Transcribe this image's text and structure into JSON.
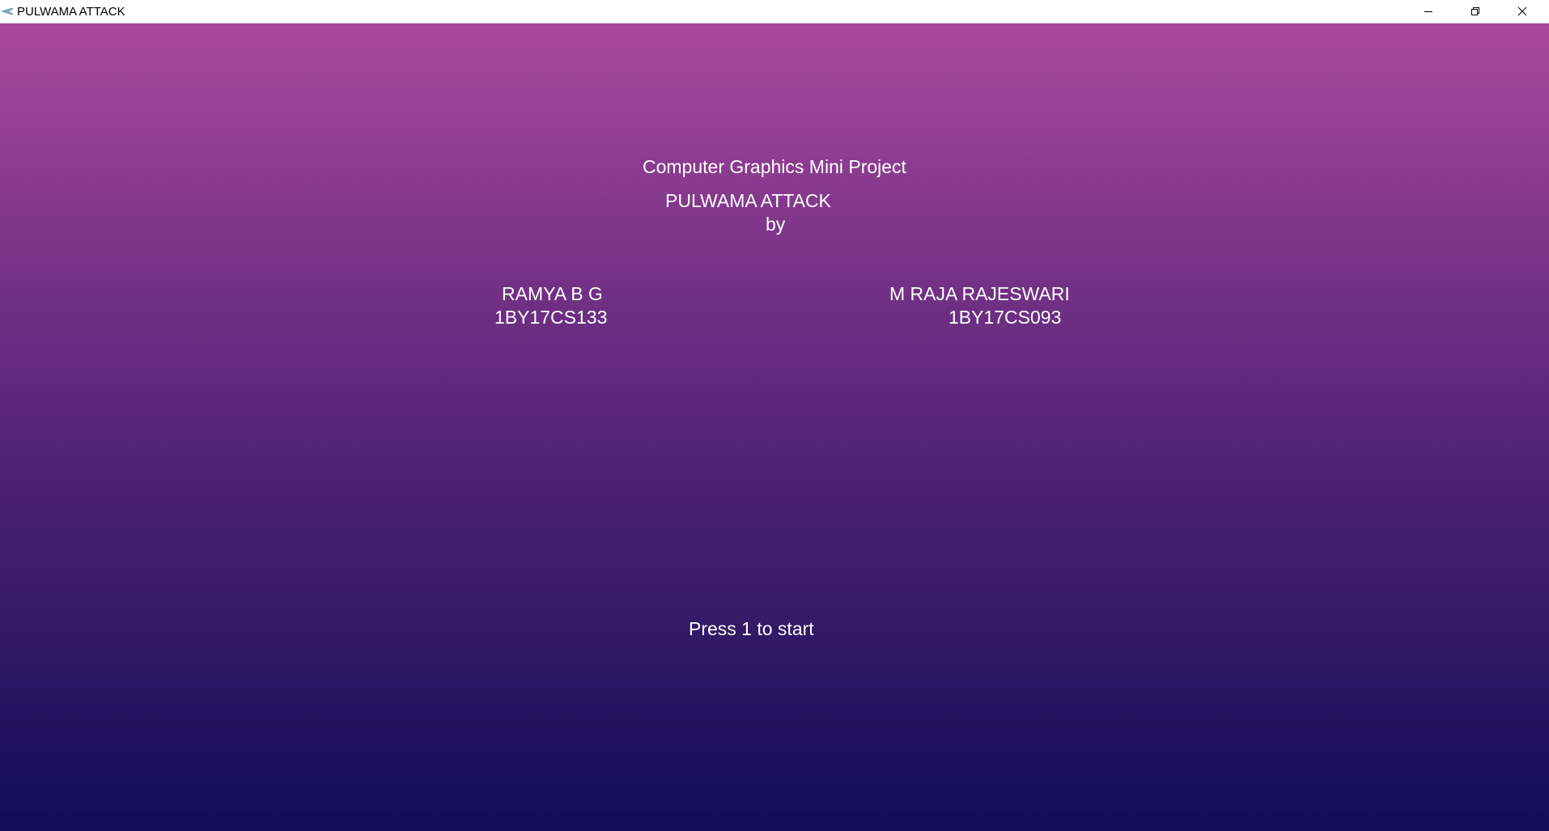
{
  "window": {
    "title": "PULWAMA ATTACK",
    "icon": "app-icon"
  },
  "controls": {
    "minimize_icon": "minimize-icon",
    "maximize_icon": "restore-icon",
    "close_icon": "close-icon"
  },
  "screen": {
    "subtitle": "Computer Graphics Mini Project",
    "project_title": "PULWAMA ATTACK",
    "by": "by",
    "authors": [
      {
        "name": "RAMYA B G",
        "usn": "1BY17CS133"
      },
      {
        "name": "M RAJA RAJESWARI",
        "usn": "1BY17CS093"
      }
    ],
    "prompt": "Press 1 to start"
  },
  "colors": {
    "gradient_top": "#a9499c",
    "gradient_bottom": "#120c55",
    "text": "#ffffff"
  }
}
